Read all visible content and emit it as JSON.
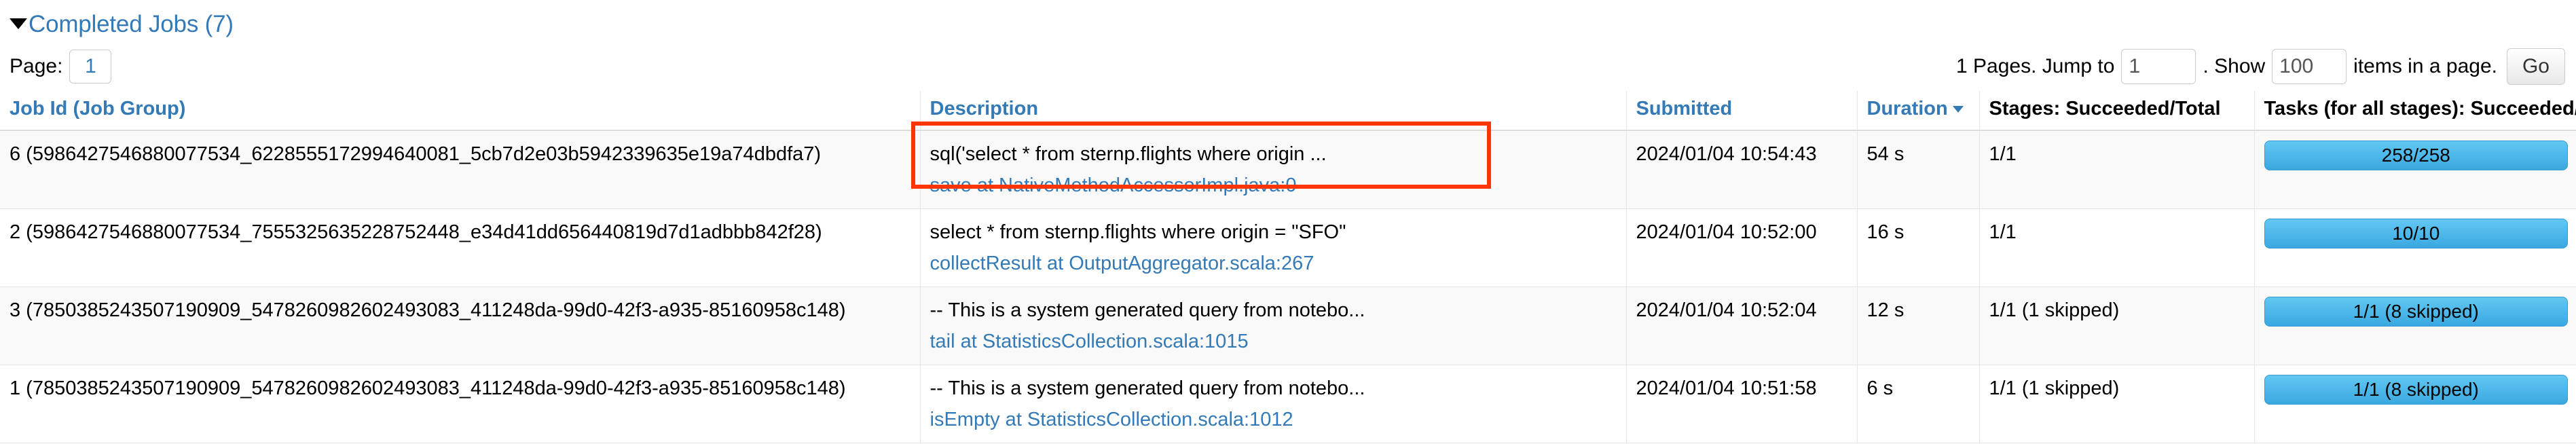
{
  "section": {
    "title": "Completed Jobs (7)",
    "caret_icon": "caret-down-icon",
    "expanded": true
  },
  "pager": {
    "page_label": "Page:",
    "page_value": "1",
    "total_pages_text": "1 Pages. Jump to",
    "jump_value": "1",
    "show_text": ". Show",
    "show_value": "100",
    "items_text": "items in a page.",
    "go_label": "Go"
  },
  "table": {
    "columns": [
      {
        "label": "Job Id (Job Group)",
        "sortable": true
      },
      {
        "label": "Description",
        "sortable": true
      },
      {
        "label": "Submitted",
        "sortable": true
      },
      {
        "label": "Duration",
        "sortable": true,
        "sorted": true,
        "sort_icon": "caret-down-icon"
      },
      {
        "label": "Stages: Succeeded/Total",
        "sortable": false
      },
      {
        "label": "Tasks (for all stages): Succeeded/Total",
        "sortable": false
      }
    ],
    "rows": [
      {
        "job_id": "6 (5986427546880077534_6228555172994640081_5cb7d2e03b5942339635e19a74dbdfa7)",
        "description": "sql('select * from sternp.flights where origin ...",
        "description_link": "save at NativeMethodAccessorImpl.java:0",
        "submitted": "2024/01/04 10:54:43",
        "duration": "54 s",
        "stages": "1/1",
        "tasks": "258/258",
        "tasks_progress_pct": 100,
        "highlighted": true
      },
      {
        "job_id": "2 (5986427546880077534_7555325635228752448_e34d41dd656440819d7d1adbbb842f28)",
        "description": "select * from sternp.flights where origin = \"SFO\"",
        "description_link": "collectResult at OutputAggregator.scala:267",
        "submitted": "2024/01/04 10:52:00",
        "duration": "16 s",
        "stages": "1/1",
        "tasks": "10/10",
        "tasks_progress_pct": 100,
        "highlighted": false
      },
      {
        "job_id": "3 (7850385243507190909_5478260982602493083_411248da-99d0-42f3-a935-85160958c148)",
        "description": "-- This is a system generated query from notebo...",
        "description_link": "tail at StatisticsCollection.scala:1015",
        "submitted": "2024/01/04 10:52:04",
        "duration": "12 s",
        "stages": "1/1 (1 skipped)",
        "tasks": "1/1 (8 skipped)",
        "tasks_progress_pct": 100,
        "highlighted": false
      },
      {
        "job_id": "1 (7850385243507190909_5478260982602493083_411248da-99d0-42f3-a935-85160958c148)",
        "description": "-- This is a system generated query from notebo...",
        "description_link": "isEmpty at StatisticsCollection.scala:1012",
        "submitted": "2024/01/04 10:51:58",
        "duration": "6 s",
        "stages": "1/1 (1 skipped)",
        "tasks": "1/1 (8 skipped)",
        "tasks_progress_pct": 100,
        "highlighted": false
      }
    ]
  },
  "colors": {
    "link": "#337ab7",
    "progress_bar": "#5bc0f0",
    "annotation_box": "#fc3503",
    "row_alt": "#f9f9f9"
  }
}
